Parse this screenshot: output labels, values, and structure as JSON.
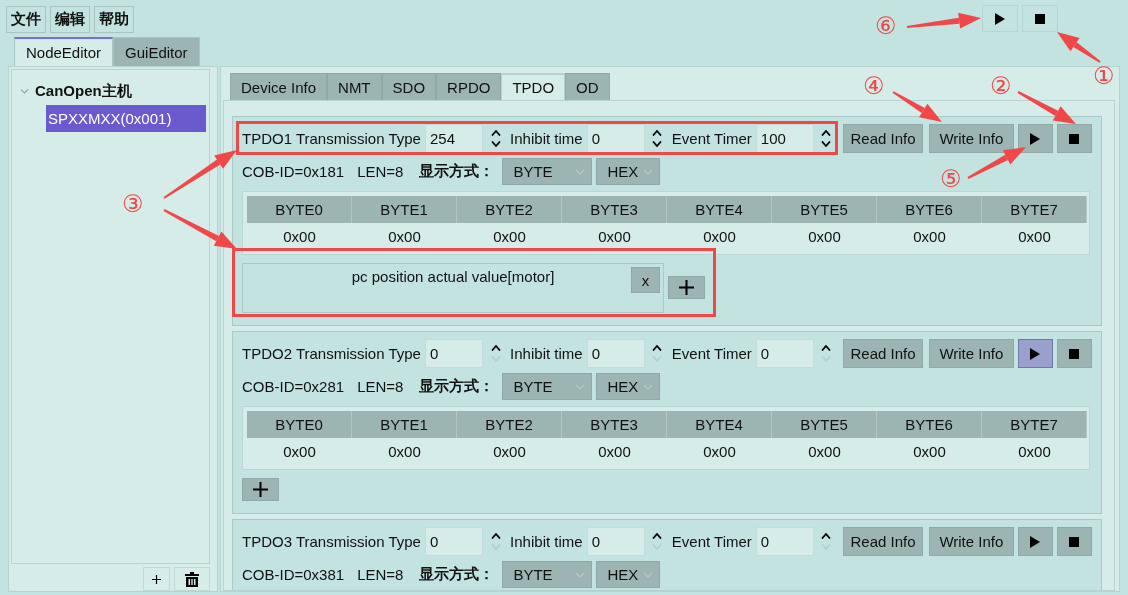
{
  "menu": [
    {
      "label": "文件"
    },
    {
      "label": "编辑"
    },
    {
      "label": "帮助"
    }
  ],
  "toolbar": [
    {
      "kind": "play"
    },
    {
      "kind": "stop"
    }
  ],
  "main_tabs": [
    {
      "label": "NodeEditor",
      "selected": true
    },
    {
      "label": "GuiEditor",
      "selected": false
    }
  ],
  "tree": {
    "items": [
      {
        "label": "CanOpen主机",
        "expanded": true,
        "selected": false,
        "children": [
          {
            "label": "SPXXMXX(0x001)",
            "selected": true
          }
        ]
      }
    ]
  },
  "tree_buttons": [
    {
      "kind": "add"
    },
    {
      "kind": "delete"
    }
  ],
  "device_tabs": [
    {
      "label": "Device Info",
      "selected": false
    },
    {
      "label": "NMT",
      "selected": false
    },
    {
      "label": "SDO",
      "selected": false
    },
    {
      "label": "RPDO",
      "selected": false
    },
    {
      "label": "TPDO",
      "selected": true
    },
    {
      "label": "OD",
      "selected": false
    }
  ],
  "groups": [
    {
      "title": "TPDO1 Transmission Type",
      "transmission_type": "254",
      "inhibit_label": "Inhibit time",
      "inhibit_time": "0",
      "event_label": "Event Timer",
      "event_timer": "100",
      "spin_down_shown": true,
      "read_button": "Read Info",
      "write_button": "Write Info",
      "play_hovered": false,
      "cob_id": "COB-ID=0x181",
      "len": "LEN=8",
      "display_label": "显示方式：",
      "format": "BYTE",
      "radix": "HEX",
      "columns": [
        "BYTE0",
        "BYTE1",
        "BYTE2",
        "BYTE3",
        "BYTE4",
        "BYTE5",
        "BYTE6",
        "BYTE7"
      ],
      "values": [
        "0x00",
        "0x00",
        "0x00",
        "0x00",
        "0x00",
        "0x00",
        "0x00",
        "0x00"
      ],
      "mappings": [
        {
          "label": "pc position actual value[motor]",
          "remove": "x"
        }
      ]
    },
    {
      "title": "TPDO2 Transmission Type",
      "transmission_type": "0",
      "inhibit_label": "Inhibit time",
      "inhibit_time": "0",
      "event_label": "Event Timer",
      "event_timer": "0",
      "spin_down_shown": false,
      "read_button": "Read Info",
      "write_button": "Write Info",
      "play_hovered": true,
      "cob_id": "COB-ID=0x281",
      "len": "LEN=8",
      "display_label": "显示方式：",
      "format": "BYTE",
      "radix": "HEX",
      "columns": [
        "BYTE0",
        "BYTE1",
        "BYTE2",
        "BYTE3",
        "BYTE4",
        "BYTE5",
        "BYTE6",
        "BYTE7"
      ],
      "values": [
        "0x00",
        "0x00",
        "0x00",
        "0x00",
        "0x00",
        "0x00",
        "0x00",
        "0x00"
      ],
      "add_button": true
    },
    {
      "title": "TPDO3 Transmission Type",
      "transmission_type": "0",
      "inhibit_label": "Inhibit time",
      "inhibit_time": "0",
      "event_label": "Event Timer",
      "event_timer": "0",
      "spin_down_shown": false,
      "read_button": "Read Info",
      "write_button": "Write Info",
      "play_hovered": false,
      "cob_id": "COB-ID=0x381",
      "len": "LEN=8",
      "display_label": "显示方式：",
      "format": "BYTE",
      "radix": "HEX"
    }
  ],
  "annotations": [
    {
      "label": "①"
    },
    {
      "label": "②"
    },
    {
      "label": "③"
    },
    {
      "label": "④"
    },
    {
      "label": "⑤"
    },
    {
      "label": "⑥"
    }
  ]
}
